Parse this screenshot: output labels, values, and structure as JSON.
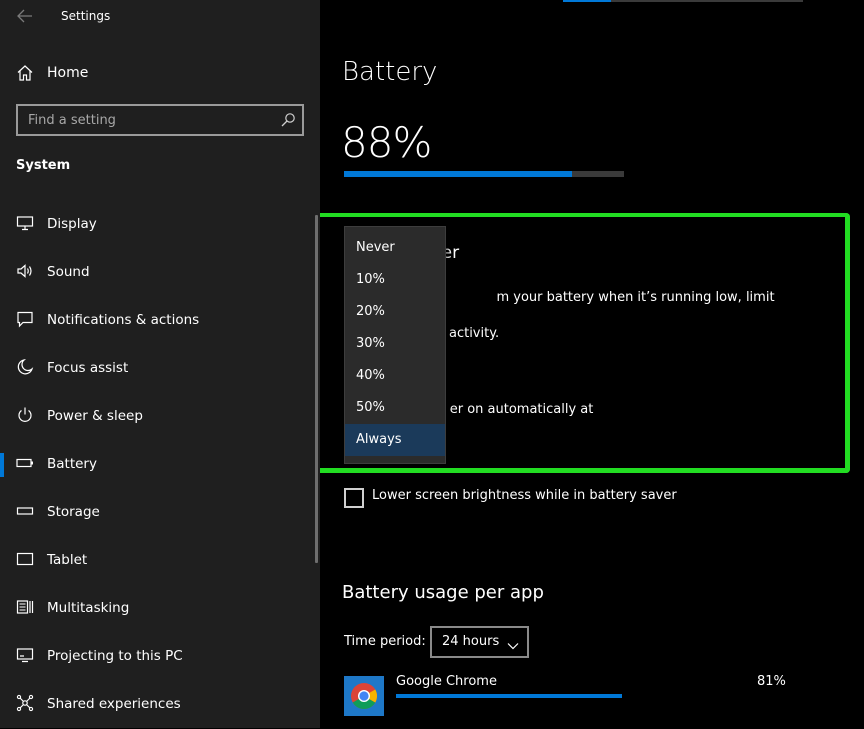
{
  "window": {
    "title": "Settings"
  },
  "sidebar": {
    "home_label": "Home",
    "search_placeholder": "Find a setting",
    "section": "System",
    "items": [
      {
        "label": "Display",
        "icon": "monitor-icon"
      },
      {
        "label": "Sound",
        "icon": "speaker-icon"
      },
      {
        "label": "Notifications & actions",
        "icon": "notification-icon"
      },
      {
        "label": "Focus assist",
        "icon": "moon-icon"
      },
      {
        "label": "Power & sleep",
        "icon": "power-icon"
      },
      {
        "label": "Battery",
        "icon": "battery-icon",
        "selected": true
      },
      {
        "label": "Storage",
        "icon": "storage-icon"
      },
      {
        "label": "Tablet",
        "icon": "tablet-icon"
      },
      {
        "label": "Multitasking",
        "icon": "multitasking-icon"
      },
      {
        "label": "Projecting to this PC",
        "icon": "projecting-icon"
      },
      {
        "label": "Shared experiences",
        "icon": "shared-experiences-icon"
      }
    ]
  },
  "main": {
    "title": "Battery",
    "battery_percent_text": "88%",
    "battery_level": 0.88,
    "saver": {
      "title_partial": "er",
      "description_line1": "m your battery when it’s running low, limit notifications",
      "description_line2": "l activity.",
      "auto_label_partial": "er on automatically at"
    },
    "dropdown": {
      "options": [
        "Never",
        "10%",
        "20%",
        "30%",
        "40%",
        "50%",
        "Always"
      ],
      "selected": "Always"
    },
    "checkbox_label": "Lower screen brightness while in battery saver",
    "usage": {
      "title": "Battery usage per app",
      "time_period_label": "Time period:",
      "time_period_value": "24 hours",
      "apps": [
        {
          "name": "Google Chrome",
          "percent_text": "81%",
          "percent": 0.81,
          "icon": "chrome-icon"
        }
      ]
    }
  },
  "colors": {
    "accent": "#0078d7",
    "highlight": "#22dd22",
    "sidebar_bg": "#1f1f1f"
  }
}
